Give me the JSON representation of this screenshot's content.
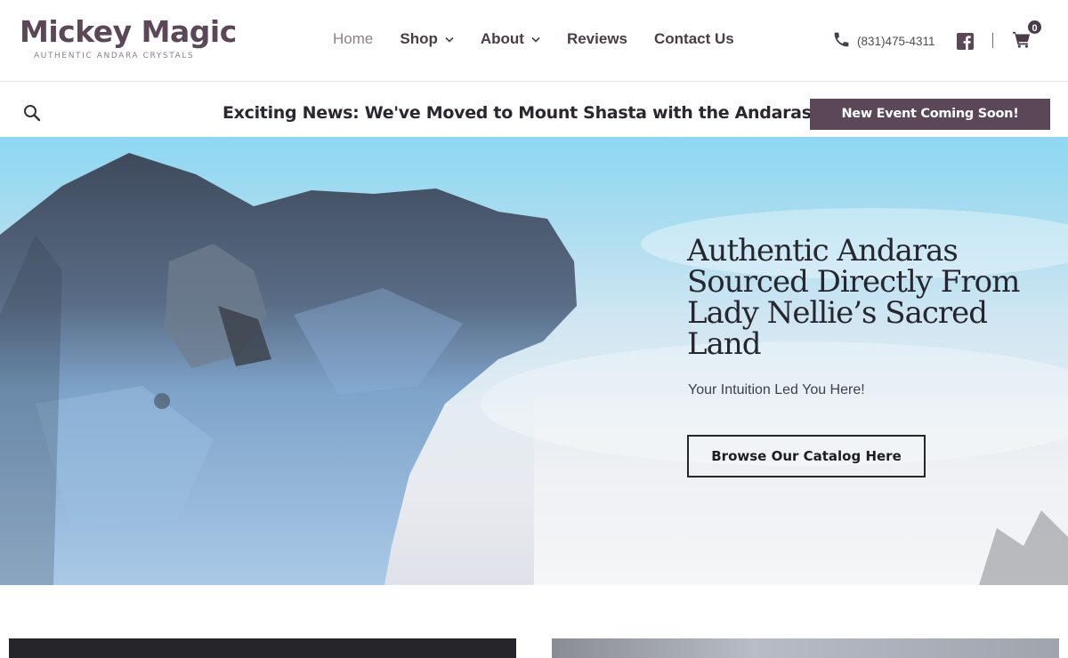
{
  "brand": {
    "title": "Mickey Magic",
    "tagline": "AUTHENTIC ANDARA CRYSTALS",
    "color": "#5b4758"
  },
  "nav": {
    "home": "Home",
    "shop": "Shop",
    "about": "About",
    "reviews": "Reviews",
    "contact": "Contact Us"
  },
  "contact": {
    "phone": "(831)475-4311"
  },
  "icons": {
    "phone": "phone-icon",
    "facebook": "facebook-icon",
    "cart": "cart-icon",
    "search": "search-icon",
    "chevron": "chevron-down-icon"
  },
  "cart": {
    "count": "0"
  },
  "announcement": {
    "text": "Exciting News: We've Moved to Mount Shasta with the Andaras!",
    "button_label": "New Event Coming Soon!"
  },
  "hero": {
    "title": "Authentic Andaras Sourced Directly From Lady Nellie’s Sacred Land",
    "subtitle": "Your Intuition Led You Here!",
    "button_label": "Browse Our Catalog Here"
  }
}
